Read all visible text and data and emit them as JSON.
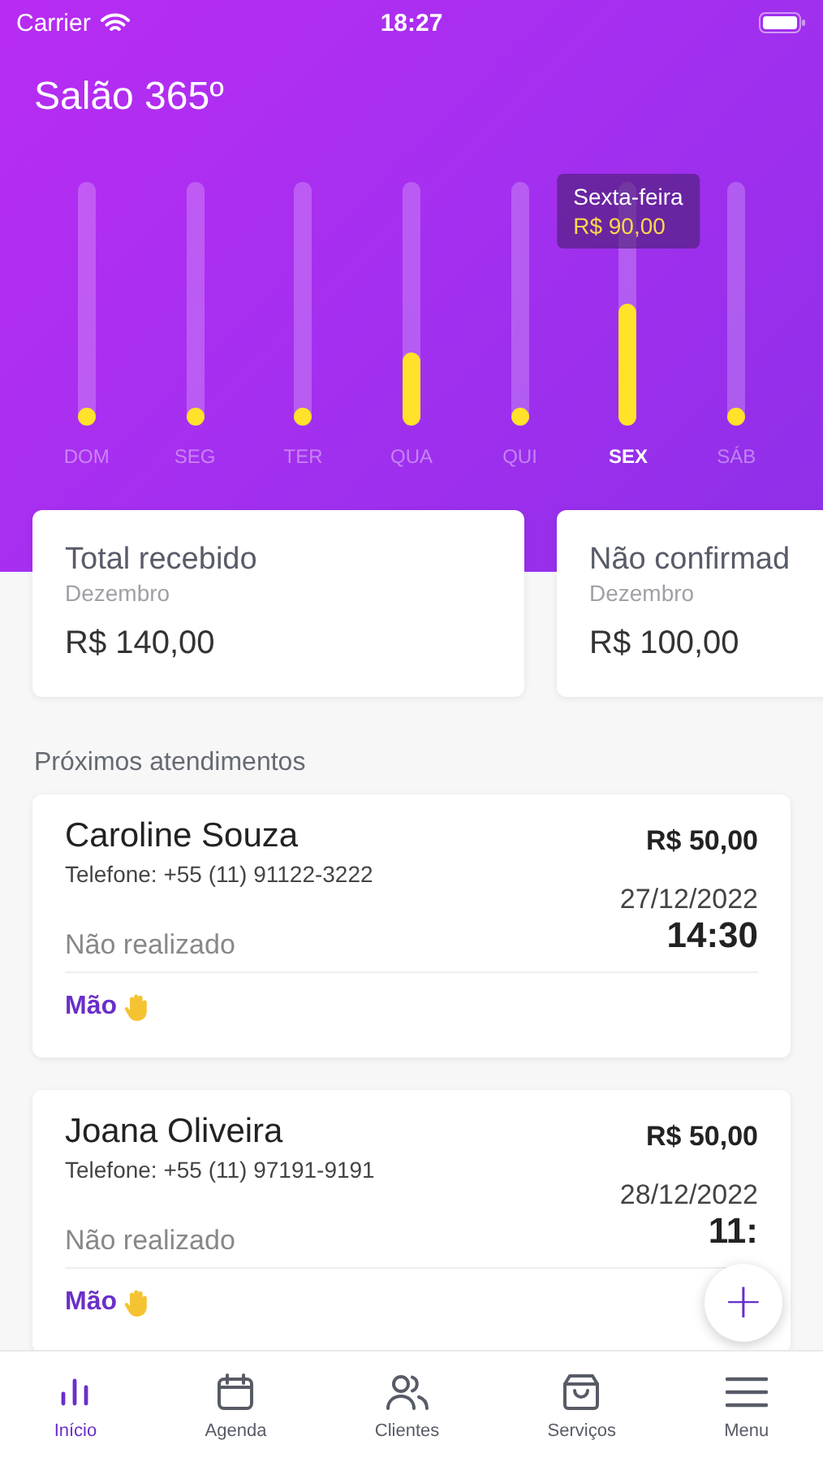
{
  "status_bar": {
    "carrier": "Carrier",
    "time": "18:27"
  },
  "title": "Salão 365º",
  "chart": {
    "days": [
      {
        "label": "DOM",
        "level": 0,
        "selected": false
      },
      {
        "label": "SEG",
        "level": 0,
        "selected": false
      },
      {
        "label": "TER",
        "level": 0,
        "selected": false
      },
      {
        "label": "QUA",
        "level": 0.3,
        "selected": false
      },
      {
        "label": "QUI",
        "level": 0,
        "selected": false
      },
      {
        "label": "SEX",
        "level": 0.5,
        "selected": true
      },
      {
        "label": "SÁB",
        "level": 0,
        "selected": false
      }
    ],
    "tooltip": {
      "title": "Sexta-feira",
      "value": "R$ 90,00"
    }
  },
  "summary_cards": [
    {
      "title": "Total recebido",
      "period": "Dezembro",
      "amount": "R$ 140,00"
    },
    {
      "title": "Não confirmad",
      "period": "Dezembro",
      "amount": "R$ 100,00"
    }
  ],
  "section_title": "Próximos atendimentos",
  "appointments": [
    {
      "name": "Caroline Souza",
      "phone": "Telefone: +55 (11) 91122-3222",
      "price": "R$ 50,00",
      "date": "27/12/2022",
      "time": "14:30",
      "status": "Não realizado",
      "service": "Mão"
    },
    {
      "name": "Joana Oliveira",
      "phone": "Telefone: +55 (11) 97191-9191",
      "price": "R$ 50,00",
      "date": "28/12/2022",
      "time": "11:",
      "status": "Não realizado",
      "service": "Mão"
    }
  ],
  "fab": {
    "label": "+"
  },
  "tab_bar": [
    {
      "kind": "chart",
      "label": "Início",
      "selected": true
    },
    {
      "kind": "calendar",
      "label": "Agenda",
      "selected": false
    },
    {
      "kind": "people",
      "label": "Clientes",
      "selected": false
    },
    {
      "kind": "bag",
      "label": "Serviços",
      "selected": false
    },
    {
      "kind": "menu",
      "label": "Menu",
      "selected": false
    }
  ]
}
